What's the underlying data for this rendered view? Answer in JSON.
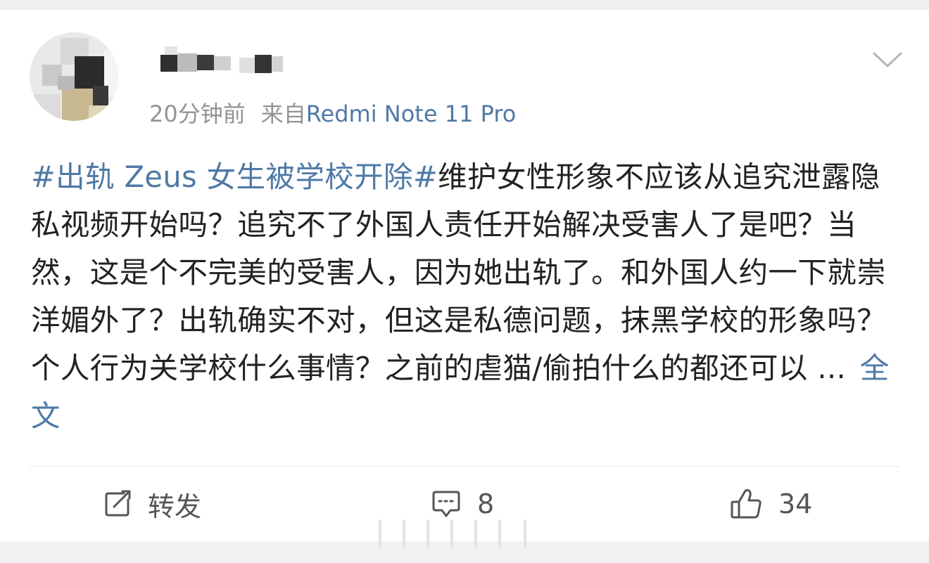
{
  "post": {
    "meta": {
      "time": "20分钟前",
      "source_prefix": "来自",
      "source_device": "Redmi Note 11 Pro"
    },
    "hashtag": "#出轨 Zeus 女生被学校开除#",
    "body_text": "维护女性形象不应该从追究泄露隐私视频开始吗？追究不了外国人责任开始解决受害人了是吧？当然，这是个不完美的受害人，因为她出轨了。和外国人约一下就崇洋媚外了？出轨确实不对，但这是私德问题，抹黑学校的形象吗？个人行为关学校什么事情？之前的虐猫/偷拍什么的都还可以 ... ",
    "full_text_link": "全文"
  },
  "actions": {
    "repost_label": "转发",
    "comment_count": "8",
    "like_count": "34"
  },
  "icons": {
    "menu": "chevron-down-icon",
    "repost": "repost-icon",
    "comment": "comment-icon",
    "like": "thumbs-up-icon"
  },
  "colors": {
    "link": "#4f79a6",
    "meta_gray": "#939393",
    "text": "#222222",
    "icon_gray": "#555555"
  }
}
